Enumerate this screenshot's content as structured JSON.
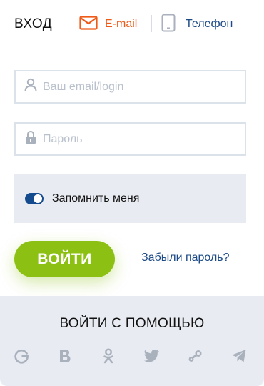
{
  "header": {
    "title": "ВХОД",
    "email_tab": "E-mail",
    "phone_tab": "Телефон"
  },
  "form": {
    "login_placeholder": "Ваш email/login",
    "password_placeholder": "Пароль",
    "remember_label": "Запомнить меня",
    "remember_on": true,
    "login_button": "ВОЙТИ",
    "forgot_link": "Забыли пароль?"
  },
  "social": {
    "heading": "ВОЙТИ С ПОМОЩЬЮ",
    "providers": [
      "google-icon",
      "vk-icon",
      "odnoklassniki-icon",
      "twitter-icon",
      "steam-icon",
      "telegram-icon"
    ]
  },
  "colors": {
    "accent_orange": "#f05a18",
    "brand_blue": "#1c4a86",
    "button_green": "#8cc114",
    "muted_gray": "#a9b1bd"
  }
}
